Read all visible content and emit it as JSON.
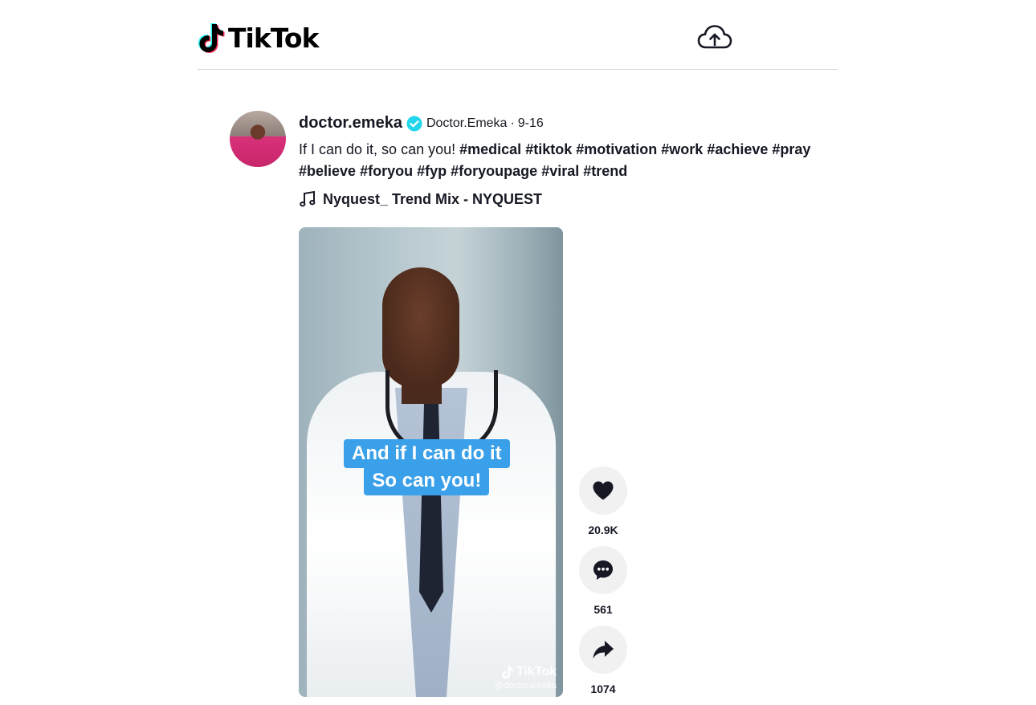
{
  "header": {
    "logo_text": "TikTok",
    "upload_icon": "cloud-upload-icon"
  },
  "post": {
    "username": "doctor.emeka",
    "verified_icon": "verified-badge-icon",
    "nickname": "Doctor.Emeka",
    "separator": "·",
    "date": "9-16",
    "caption_text": "If I can do it, so can you!",
    "hashtags": [
      "#medical",
      "#tiktok",
      "#motivation",
      "#work",
      "#achieve",
      "#pray",
      "#believe",
      "#foryou",
      "#fyp",
      "#foryoupage",
      "#viral",
      "#trend"
    ],
    "music_icon": "music-note-icon",
    "music": "Nyquest_ Trend Mix - NYQUEST"
  },
  "video": {
    "caption_lines": [
      "And if I can do it",
      "So can you!"
    ],
    "watermark_logo": "TikTok",
    "watermark_handle": "@doctor.emeka"
  },
  "actions": {
    "likes": "20.9K",
    "comments": "561",
    "shares": "1074"
  },
  "colors": {
    "caption_bg": "#3aa0e9",
    "verified": "#20d5ec",
    "tiktok_cyan": "#25f4ee",
    "tiktok_red": "#fe2c55"
  }
}
